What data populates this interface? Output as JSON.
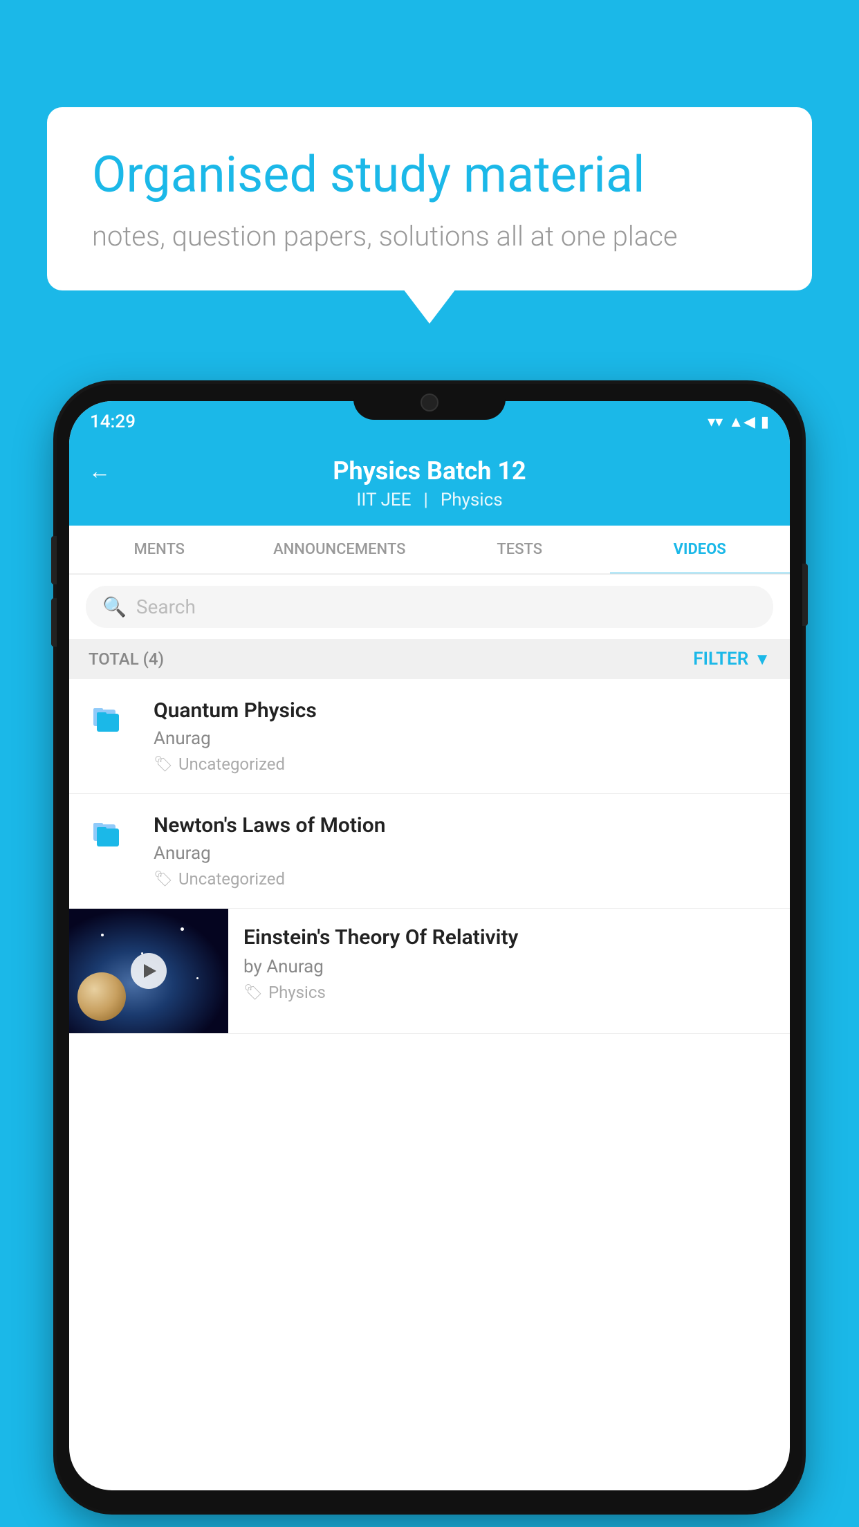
{
  "background": {
    "color": "#1BB8E8"
  },
  "speech_bubble": {
    "title": "Organised study material",
    "subtitle": "notes, question papers, solutions all at one place"
  },
  "status_bar": {
    "time": "14:29",
    "wifi": "▼",
    "signal": "▲",
    "battery": "▮"
  },
  "header": {
    "title": "Physics Batch 12",
    "tag1": "IIT JEE",
    "tag2": "Physics",
    "back_label": "←"
  },
  "tabs": [
    {
      "label": "MENTS",
      "active": false
    },
    {
      "label": "ANNOUNCEMENTS",
      "active": false
    },
    {
      "label": "TESTS",
      "active": false
    },
    {
      "label": "VIDEOS",
      "active": true
    }
  ],
  "search": {
    "placeholder": "Search"
  },
  "filter_bar": {
    "total_label": "TOTAL (4)",
    "filter_label": "FILTER"
  },
  "list_items": [
    {
      "title": "Quantum Physics",
      "author": "Anurag",
      "tag": "Uncategorized",
      "has_thumb": false
    },
    {
      "title": "Newton's Laws of Motion",
      "author": "Anurag",
      "tag": "Uncategorized",
      "has_thumb": false
    },
    {
      "title": "Einstein's Theory Of Relativity",
      "author": "by Anurag",
      "tag": "Physics",
      "has_thumb": true
    }
  ]
}
